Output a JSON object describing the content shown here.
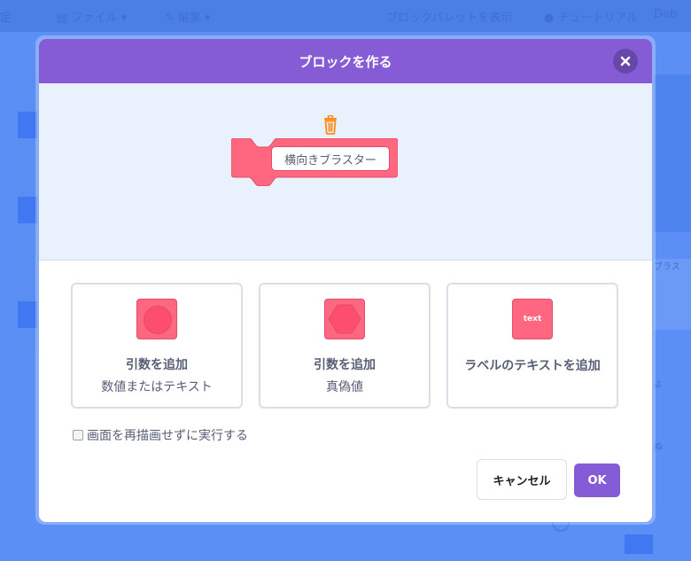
{
  "menubar": {
    "items": [
      "定",
      "ファイル",
      "編集",
      "",
      "ブロックパレットを表示",
      "チュートリアル",
      "Deb"
    ]
  },
  "background": {
    "right_label": "ブラス",
    "small_a": "よ",
    "small_b": "ぬ"
  },
  "dialog": {
    "title": "ブロックを作る",
    "close_icon": "close-icon",
    "trash_icon": "trash-icon",
    "block_text": "横向きブラスター",
    "options": [
      {
        "title": "引数を追加",
        "subtitle": "数値またはテキスト",
        "icon": "round-input-icon"
      },
      {
        "title": "引数を追加",
        "subtitle": "真偽値",
        "icon": "boolean-input-icon"
      },
      {
        "title": "ラベルのテキストを追加",
        "icon_text": "text",
        "icon": "label-text-icon"
      }
    ],
    "checkbox_label": "画面を再描画せずに実行する",
    "checkbox_checked": false,
    "cancel_label": "キャンセル",
    "ok_label": "OK"
  },
  "colors": {
    "header": "#855cd6",
    "block": "#ff6680",
    "block_border": "#e14e6a",
    "trash": "#ff8c1a",
    "workspace_bg": "#e9f1fc",
    "app_bg": "#5b8ff5"
  }
}
